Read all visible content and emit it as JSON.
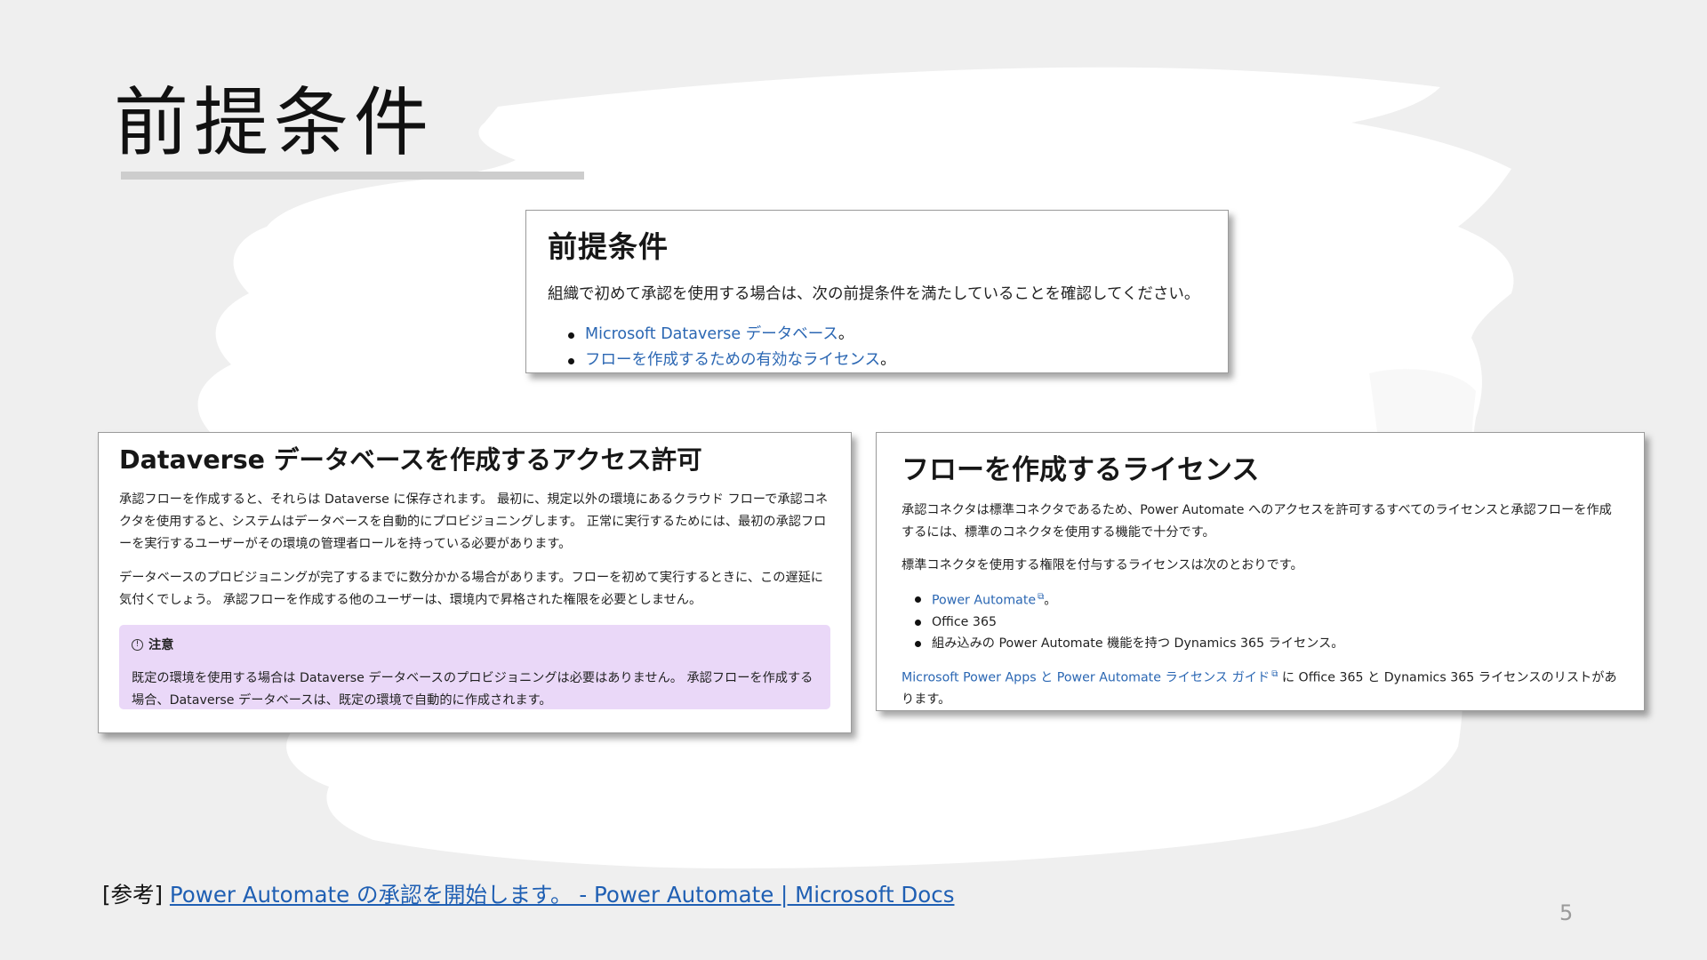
{
  "slide": {
    "title": "前提条件",
    "page_number": "5"
  },
  "prereq_card": {
    "heading": "前提条件",
    "intro": "組織で初めて承認を使用する場合は、次の前提条件を満たしていることを確認してください。",
    "items": [
      {
        "link": "Microsoft Dataverse データベース",
        "suffix": "。"
      },
      {
        "link": "フローを作成するための有効なライセンス",
        "suffix": "。"
      }
    ]
  },
  "dataverse_card": {
    "heading": "Dataverse データベースを作成するアクセス許可",
    "p1": "承認フローを作成すると、それらは Dataverse に保存されます。 最初に、規定以外の環境にあるクラウド フローで承認コネクタを使用すると、システムはデータベースを自動的にプロビジョニングします。 正常に実行するためには、最初の承認フローを実行するユーザーがその環境の管理者ロールを持っている必要があります。",
    "p2": "データベースのプロビジョニングが完了するまでに数分かかる場合があります。フローを初めて実行するときに、この遅延に気付くでしょう。 承認フローを作成する他のユーザーは、環境内で昇格された権限を必要としません。",
    "note": {
      "icon_glyph": "!",
      "label": "注意",
      "body": "既定の環境を使用する場合は Dataverse データベースのプロビジョニングは必要はありません。 承認フローを作成する場合、Dataverse データベースは、既定の環境で自動的に作成されます。"
    }
  },
  "license_card": {
    "heading": "フローを作成するライセンス",
    "p1": "承認コネクタは標準コネクタであるため、Power Automate へのアクセスを許可するすべてのライセンスと承認フローを作成するには、標準のコネクタを使用する機能で十分です。",
    "p2": "標準コネクタを使用する権限を付与するライセンスは次のとおりです。",
    "items": [
      {
        "link": "Power Automate",
        "text": "",
        "suffix": "。"
      },
      {
        "link": "",
        "text": "Office 365",
        "suffix": ""
      },
      {
        "link": "",
        "text": "組み込みの Power Automate 機能を持つ Dynamics 365 ライセンス。",
        "suffix": ""
      }
    ],
    "guide_link": "Microsoft Power Apps と Power Automate ライセンス ガイド",
    "guide_rest": " に Office 365 と Dynamics 365 ライセンスのリストがあります。",
    "external_glyph": "⧉"
  },
  "reference": {
    "prefix": "[参考] ",
    "link_text": "Power Automate の承認を開始します。 - Power Automate | Microsoft Docs"
  },
  "colors": {
    "link": "#2b67b3",
    "note_background": "#ead8f8",
    "slide_background": "#efefef"
  }
}
